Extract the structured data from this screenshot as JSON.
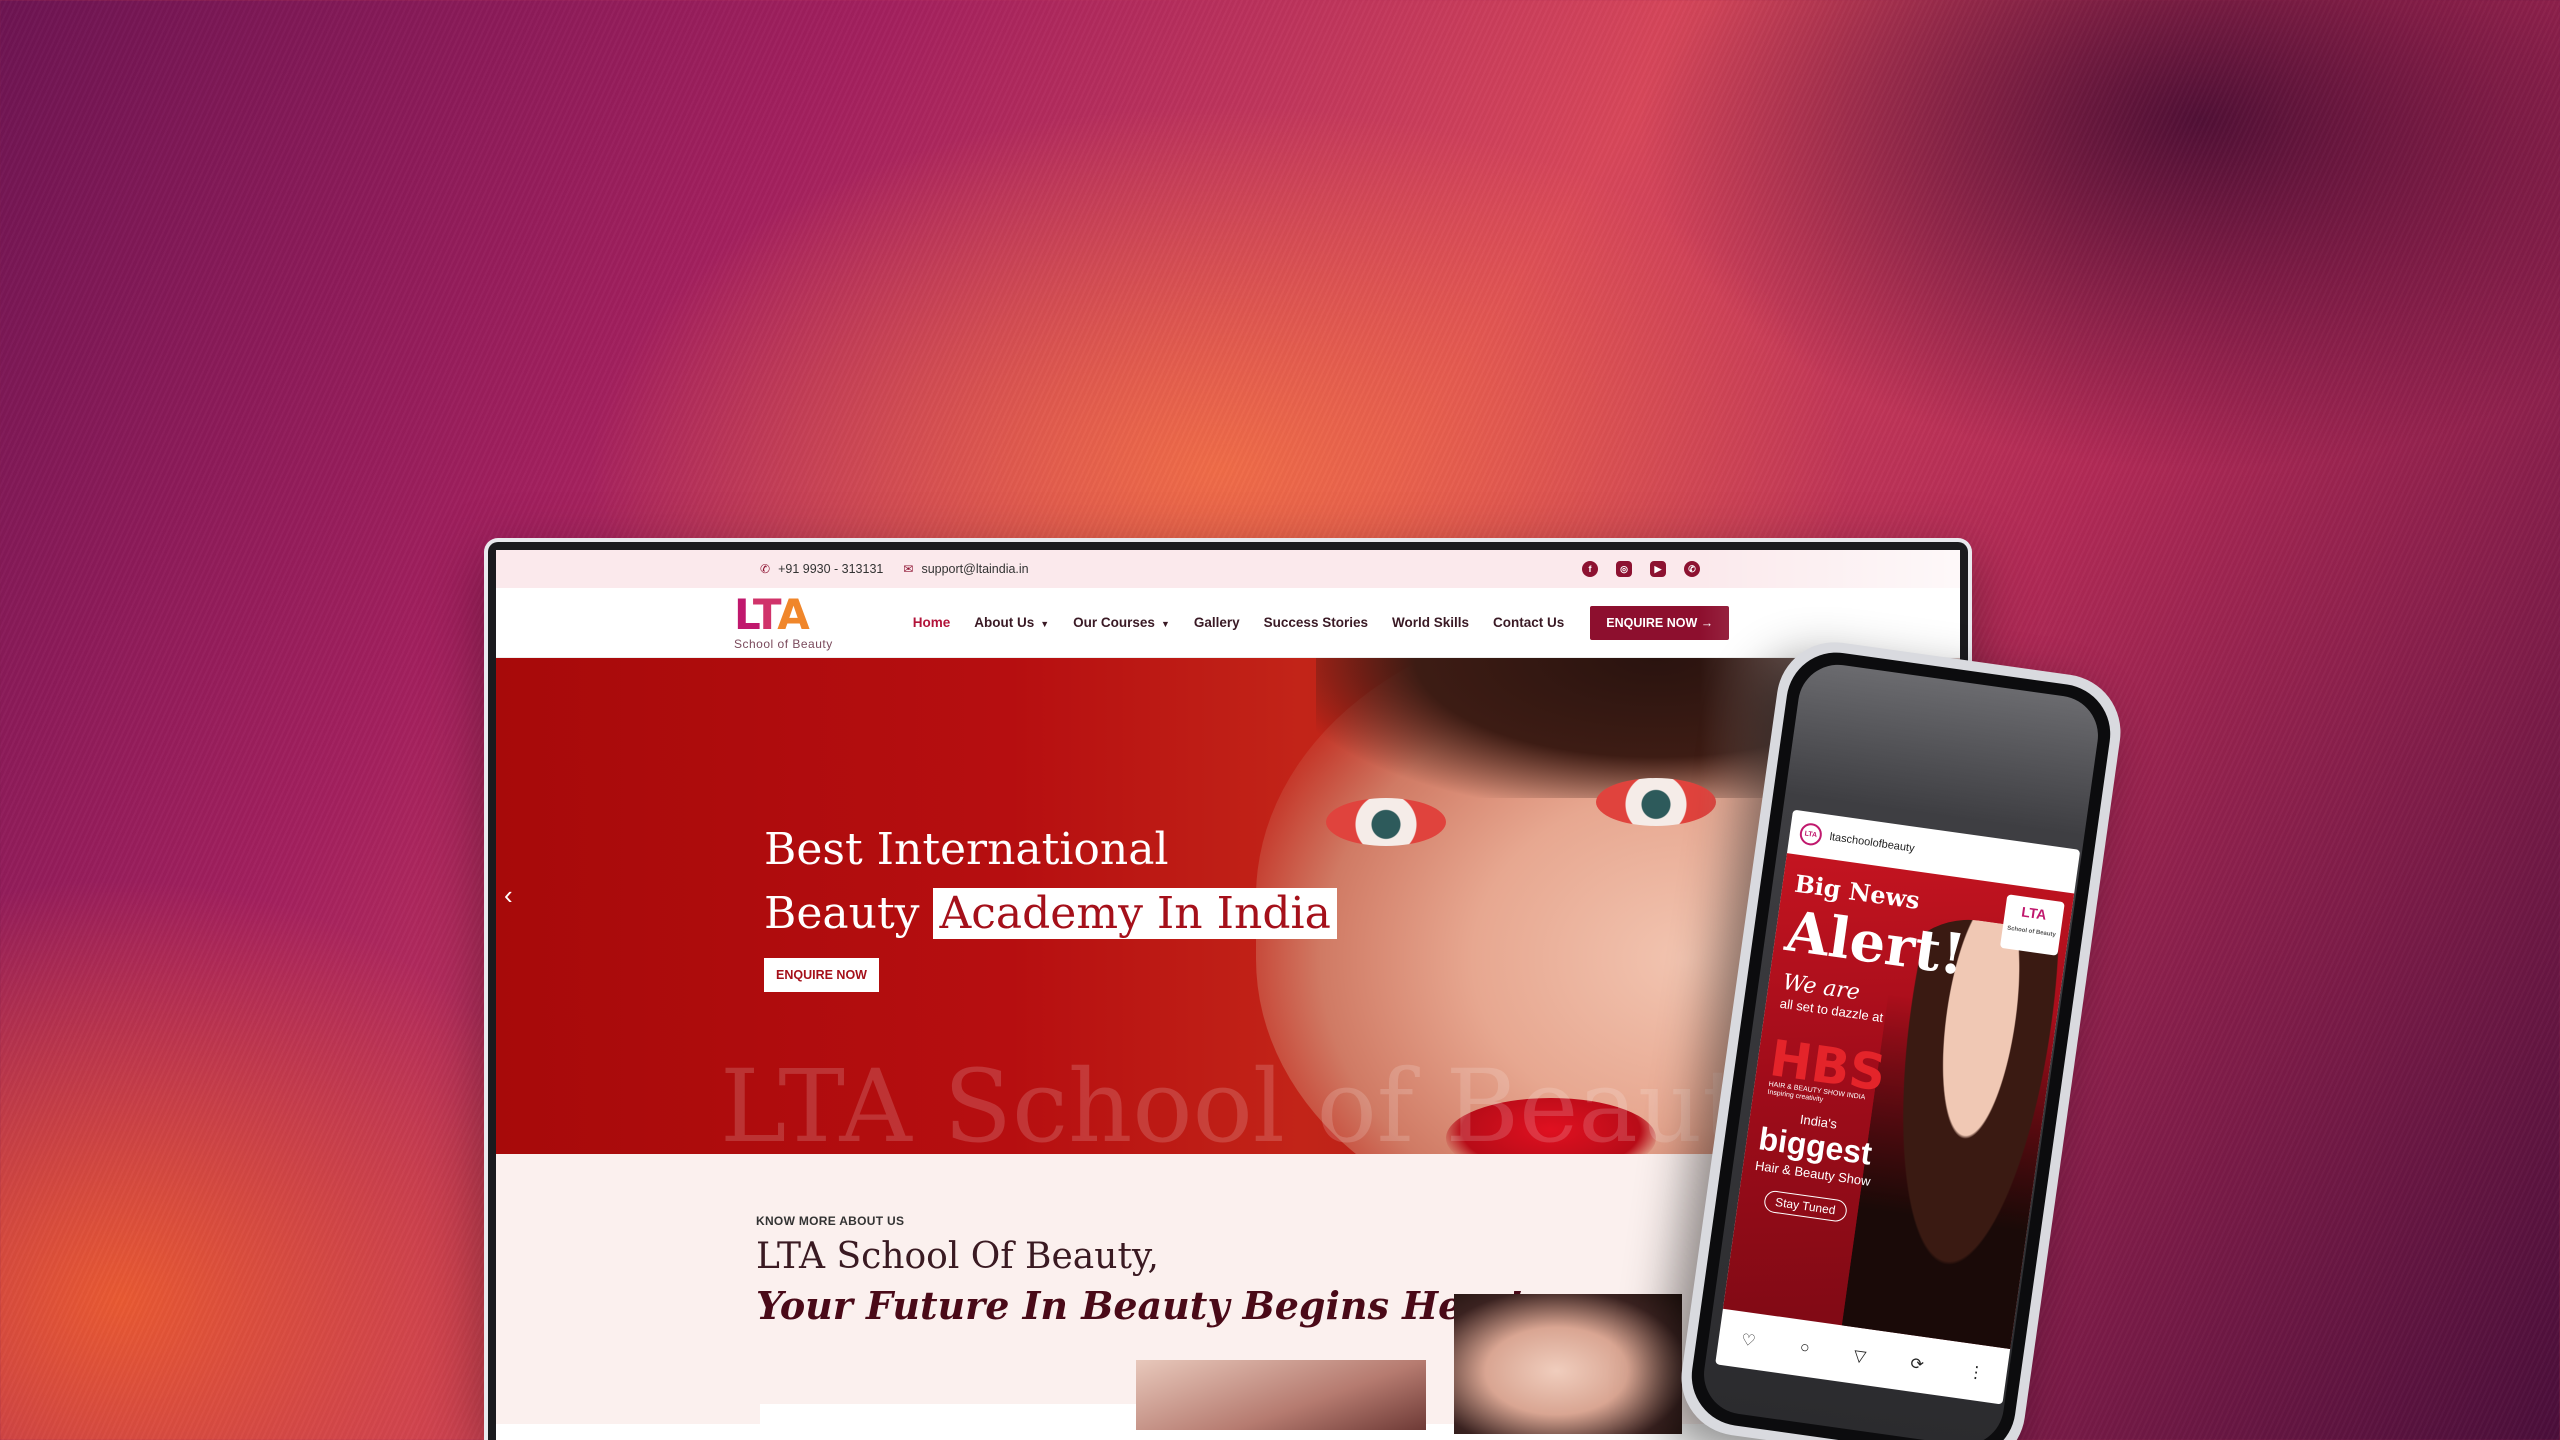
{
  "topbar": {
    "phone": "+91 9930 - 313131",
    "email": "support@ltaindia.in",
    "socials": [
      "facebook-icon",
      "instagram-icon",
      "youtube-icon",
      "whatsapp-icon"
    ]
  },
  "brand": {
    "logo_l": "L",
    "logo_t": "T",
    "logo_a": "A",
    "tagline": "School of Beauty"
  },
  "nav": {
    "items": [
      {
        "label": "Home"
      },
      {
        "label": "About Us"
      },
      {
        "label": "Our Courses"
      },
      {
        "label": "Gallery"
      },
      {
        "label": "Success Stories"
      },
      {
        "label": "World Skills"
      },
      {
        "label": "Contact Us"
      }
    ],
    "cta": "ENQUIRE NOW →"
  },
  "hero": {
    "line1": "Best International",
    "line2a": "Beauty",
    "line2b": "Academy In India",
    "button": "ENQUIRE NOW",
    "watermark": "LTA School of Beauty",
    "prev": "‹"
  },
  "about": {
    "kicker": "KNOW MORE ABOUT US",
    "title": "LTA School Of Beauty,",
    "subtitle": "Your Future In Beauty Begins Here!"
  },
  "phone_post": {
    "handle": "ltaschoolofbeauty",
    "badge": "LTA",
    "badge_sub": "School of Beauty",
    "big_news": "Big News",
    "alert": "Alert!",
    "we_are": "We are",
    "dazzle": "all set to dazzle at",
    "hbs": "HBS",
    "hbs_sub": "HAIR & BEAUTY SHOW INDIA Inspiring creativity",
    "indias": "India's",
    "biggest": "biggest",
    "show": "Hair & Beauty Show",
    "stay": "Stay Tuned"
  },
  "colors": {
    "brand_maroon": "#8d0f2e",
    "hero_red": "#b60e10",
    "accent_pink": "#c0186d"
  }
}
